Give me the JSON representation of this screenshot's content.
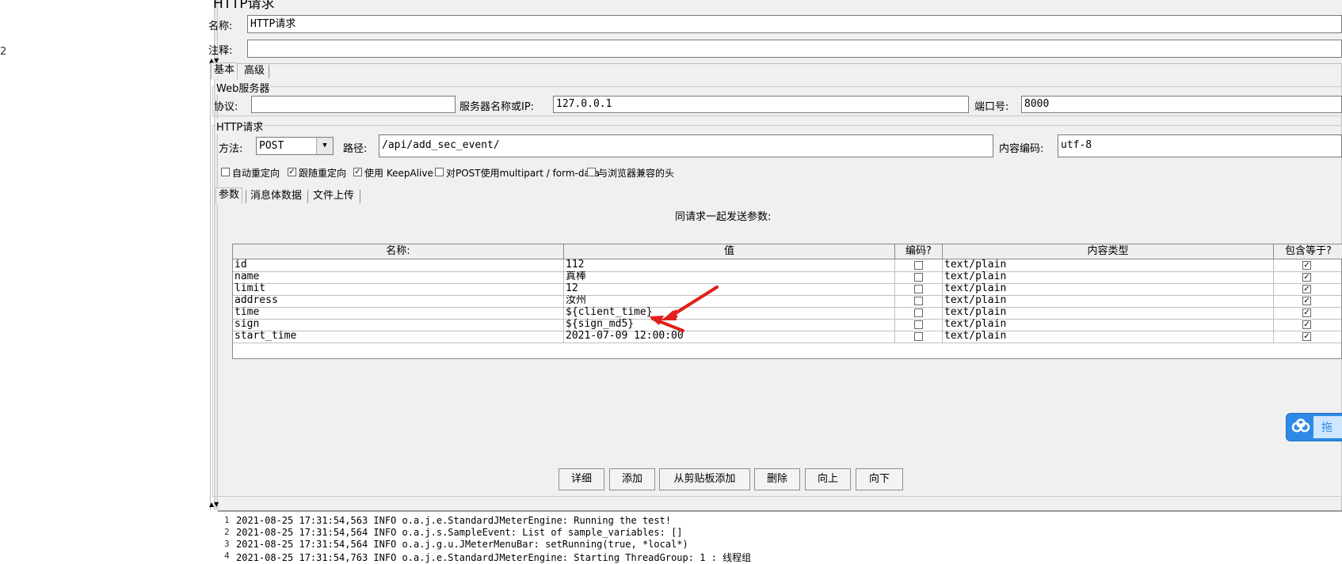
{
  "left_pane": {
    "tree_glyph": "2"
  },
  "header": {
    "title": "HTTP请求",
    "name_label": "名称:",
    "name_value": "HTTP请求",
    "comment_label": "注释:",
    "comment_value": ""
  },
  "tabs": {
    "basic": "基本",
    "advanced": "高级"
  },
  "web_server": {
    "group_title": "Web服务器",
    "protocol_label": "协议:",
    "protocol_value": "",
    "server_label": "服务器名称或IP:",
    "server_value": "127.0.0.1",
    "port_label": "端口号:",
    "port_value": "8000"
  },
  "http_request": {
    "group_title": "HTTP请求",
    "method_label": "方法:",
    "method_value": "POST",
    "path_label": "路径:",
    "path_value": "/api/add_sec_event/",
    "encoding_label": "内容编码:",
    "encoding_value": "utf-8",
    "options": [
      {
        "label": "自动重定向",
        "checked": false
      },
      {
        "label": "跟随重定向",
        "checked": true
      },
      {
        "label": "使用 KeepAlive",
        "checked": true
      },
      {
        "label": "对POST使用multipart / form-data",
        "checked": false
      },
      {
        "label": "与浏览器兼容的头",
        "checked": false
      }
    ]
  },
  "sub_tabs": [
    "参数",
    "消息体数据",
    "文件上传"
  ],
  "params": {
    "caption": "同请求一起发送参数:",
    "headers": [
      "名称:",
      "值",
      "编码?",
      "内容类型",
      "包含等于?"
    ],
    "rows": [
      {
        "name": "id",
        "value": "112",
        "encode": false,
        "type": "text/plain",
        "include_equals": true
      },
      {
        "name": "name",
        "value": "真棒",
        "encode": false,
        "type": "text/plain",
        "include_equals": true
      },
      {
        "name": "limit",
        "value": "12",
        "encode": false,
        "type": "text/plain",
        "include_equals": true
      },
      {
        "name": "address",
        "value": "汝州",
        "encode": false,
        "type": "text/plain",
        "include_equals": true
      },
      {
        "name": "time",
        "value": "${client_time}",
        "encode": false,
        "type": "text/plain",
        "include_equals": true
      },
      {
        "name": "sign",
        "value": "${sign_md5}",
        "encode": false,
        "type": "text/plain",
        "include_equals": true
      },
      {
        "name": "start_time",
        "value": "2021-07-09 12:00:00",
        "encode": false,
        "type": "text/plain",
        "include_equals": true
      }
    ]
  },
  "buttons": {
    "detail": "详细",
    "add": "添加",
    "add_from_clipboard": "从剪贴板添加",
    "delete": "删除",
    "up": "向上",
    "down": "向下"
  },
  "widget": {
    "label": "拖"
  },
  "log": [
    {
      "num": "1",
      "text": "2021-08-25 17:31:54,563 INFO o.a.j.e.StandardJMeterEngine: Running the test!"
    },
    {
      "num": "2",
      "text": "2021-08-25 17:31:54,564 INFO o.a.j.s.SampleEvent: List of sample_variables: []"
    },
    {
      "num": "3",
      "text": "2021-08-25 17:31:54,564 INFO o.a.j.g.u.JMeterMenuBar: setRunning(true, *local*)"
    },
    {
      "num": "4",
      "text": "2021-08-25 17:31:54,763 INFO o.a.j.e.StandardJMeterEngine: Starting ThreadGroup: 1 : 线程组"
    }
  ],
  "colors": {
    "panel_bg": "#f0f0f0",
    "annotation_arrow": "#e0201a",
    "widget_blue": "#2e8ae6"
  }
}
